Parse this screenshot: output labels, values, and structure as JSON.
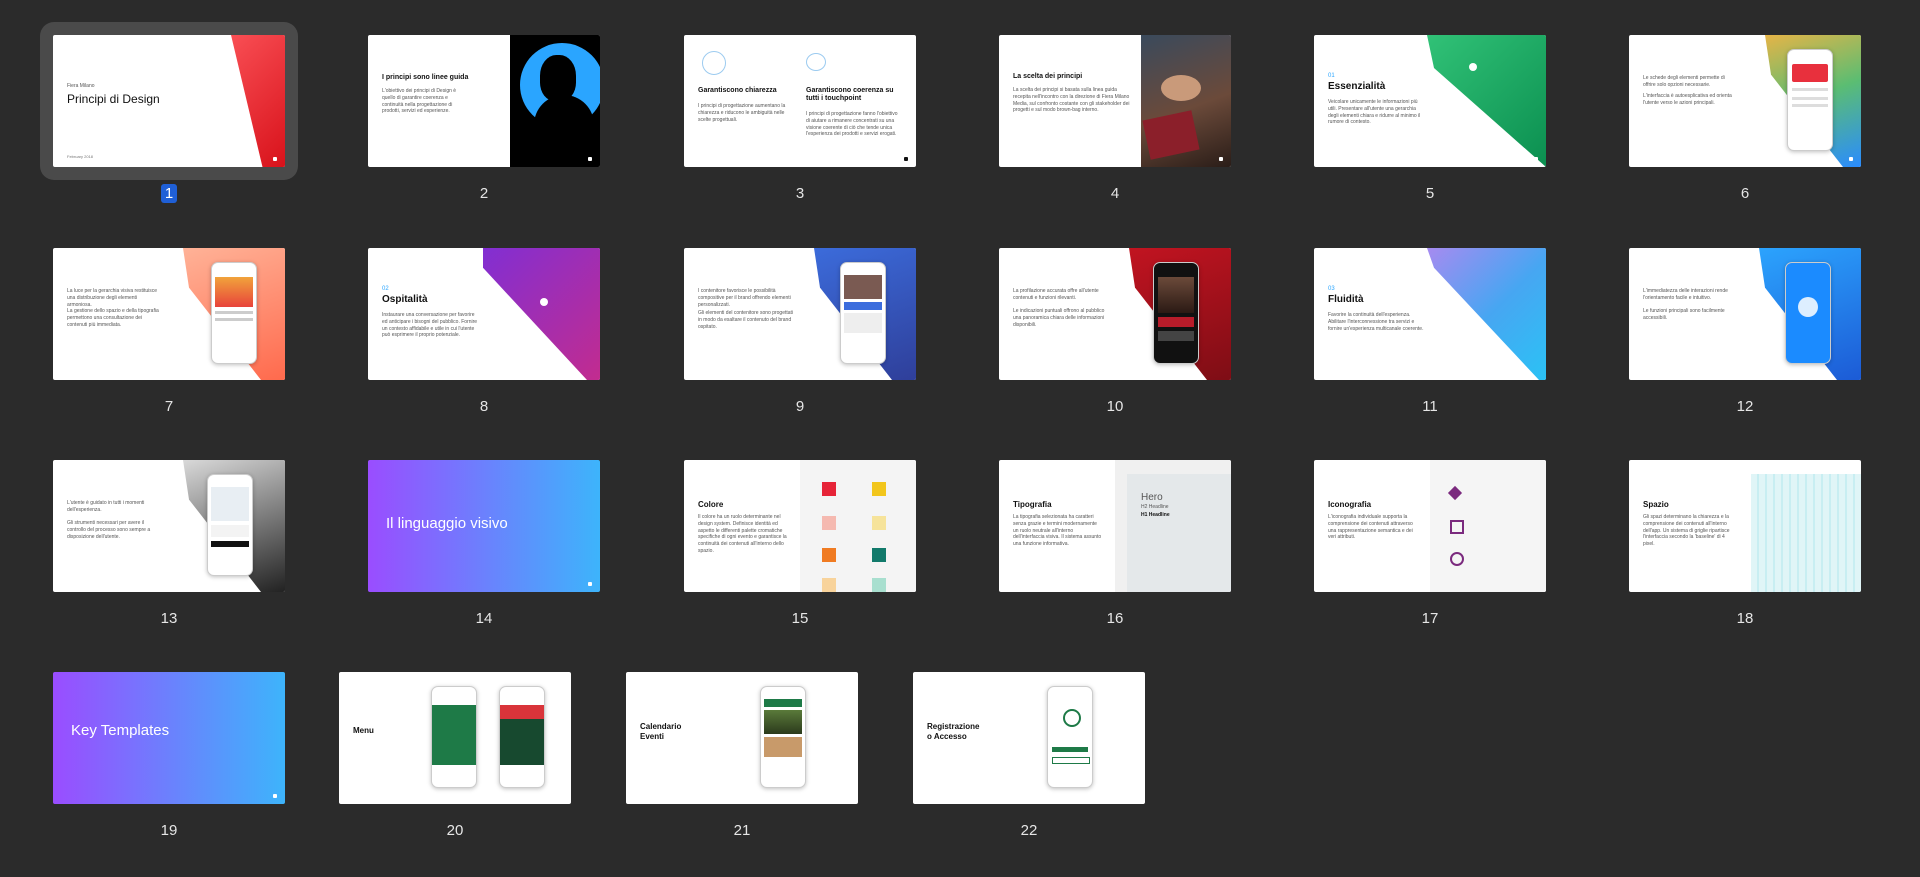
{
  "slides": [
    {
      "num": "1",
      "selected": true,
      "author": "Fiera Milano",
      "title": "Principi di Design",
      "date": "February 2018"
    },
    {
      "num": "2",
      "title": "I principi sono linee guida",
      "body": "L'obiettivo dei principi di Design è quello di garantire coerenza e continuità nella progettazione di prodotti, servizi ed esperienze."
    },
    {
      "num": "3",
      "title_left": "Garantiscono chiarezza",
      "title_right": "Garantiscono coerenza su tutti i touchpoint",
      "body_left": "I principi di progettazione aumentano la chiarezza e riducono le ambiguità nelle scelte progettuali.",
      "body_right": "I principi di progettazione fanno l'obiettivo di aiutare a rimanere concentrati su una visione coerente di ciò che tende unica l'esperienza dei prodotti e servizi erogati."
    },
    {
      "num": "4",
      "title": "La scelta dei principi",
      "body": "La scelta dei principi si basata sulla linea guida recepita nell'incontro con la direzione di Fiera Milano Media, sul confronto costante con gli stakeholder dei progetti e sul modo brown-bag interno."
    },
    {
      "num": "5",
      "index": "01",
      "title": "Essenzialità",
      "body": "Veicolare unicamente le informazioni più utili. Presentare all'utente una gerarchia degli elementi chiara e ridurre al minimo il rumore di contesto."
    },
    {
      "num": "6",
      "bullets": [
        "Le schede degli elementi permette di offrire solo opzioni necessarie.",
        "L'interfaccia è autoesplicativa ed orienta l'utente verso le azioni principali."
      ]
    },
    {
      "num": "7",
      "bullets": [
        "La luce per la gerarchia visiva restituisce una distribuzione degli elementi armoniosa.",
        "La gestione dello spazio e della tipografia permettono una consultazione dei contenuti più immediata."
      ]
    },
    {
      "num": "8",
      "index": "02",
      "title": "Ospitalità",
      "body": "Instaurare una conversazione per favorire ed anticipare i bisogni del pubblico. Fornire un contesto affidabile e utile in cui l'utente può esprimere il proprio potenziale."
    },
    {
      "num": "9",
      "bullets": [
        "I contenitore favorisce le possibilità compositive per il brand offrendo elementi personalizzati.",
        "Gli elementi del contenitore sono progettati in modo da esaltare il contenuto del brand ospitato."
      ]
    },
    {
      "num": "10",
      "bullets": [
        "La profilazione accurata offre all'utente contenuti e funzioni rilevanti.",
        "Le indicazioni puntuali offrono al pubblico una panoramica chiara delle informazioni disponibili."
      ]
    },
    {
      "num": "11",
      "index": "03",
      "title": "Fluidità",
      "body": "Favorire la continuità dell'esperienza. Abilitare l'interconnessione tra servizi e fornire un'esperienza multicanale coerente."
    },
    {
      "num": "12",
      "bullets": [
        "L'immediatezza delle interazioni rende l'orientamento facile e intuitivo.",
        "Le funzioni principali sono facilmente accessibili."
      ]
    },
    {
      "num": "13",
      "bullets": [
        "L'utente è guidato in tutti i momenti dell'esperienza.",
        "Gli strumenti necessari per avere il controllo del processo sono sempre a disposizione dell'utente."
      ]
    },
    {
      "num": "14",
      "title": "Il linguaggio visivo"
    },
    {
      "num": "15",
      "title": "Colore",
      "body": "Il colore ha un ruolo determinante nel design system. Definisce identità ed aspetto le differenti palette cromatiche specifiche di ogni evento e garantisce la continuità dei contenuti all'interno dello spazio."
    },
    {
      "num": "16",
      "title": "Tipografia",
      "body": "La tipografia selezionata ha caratteri senza grazie e termini modernamente un ruolo neutrale all'interno dell'interfaccia visiva. Il sistema assunto una funzione informativa.",
      "type_big": "Hero",
      "type_h1": "H1 Headline",
      "type_h2": "H2 Headline"
    },
    {
      "num": "17",
      "title": "Iconografia",
      "body": "L'iconografia individuale supporta la comprensione dei contenuti attraverso una rappresentazione semantica e dei veri attributi."
    },
    {
      "num": "18",
      "title": "Spazio",
      "body": "Gli spazi determinano la chiarezza e la comprensione dei contenuti all'interno dell'app. Un sistema di griglie ripartisce l'interfaccia secondo la 'baseline' di 4 pixel."
    },
    {
      "num": "19",
      "title": "Key Templates"
    },
    {
      "num": "20",
      "title": "Menu"
    },
    {
      "num": "21",
      "title": "Calendario\nEventi"
    },
    {
      "num": "22",
      "title": "Registrazione\no Accesso"
    }
  ],
  "colors": {
    "background": "#2b2b2b",
    "selection": "#1f5fd6",
    "section_gradient_start": "#9a4dff",
    "section_gradient_end": "#3db4fb"
  }
}
